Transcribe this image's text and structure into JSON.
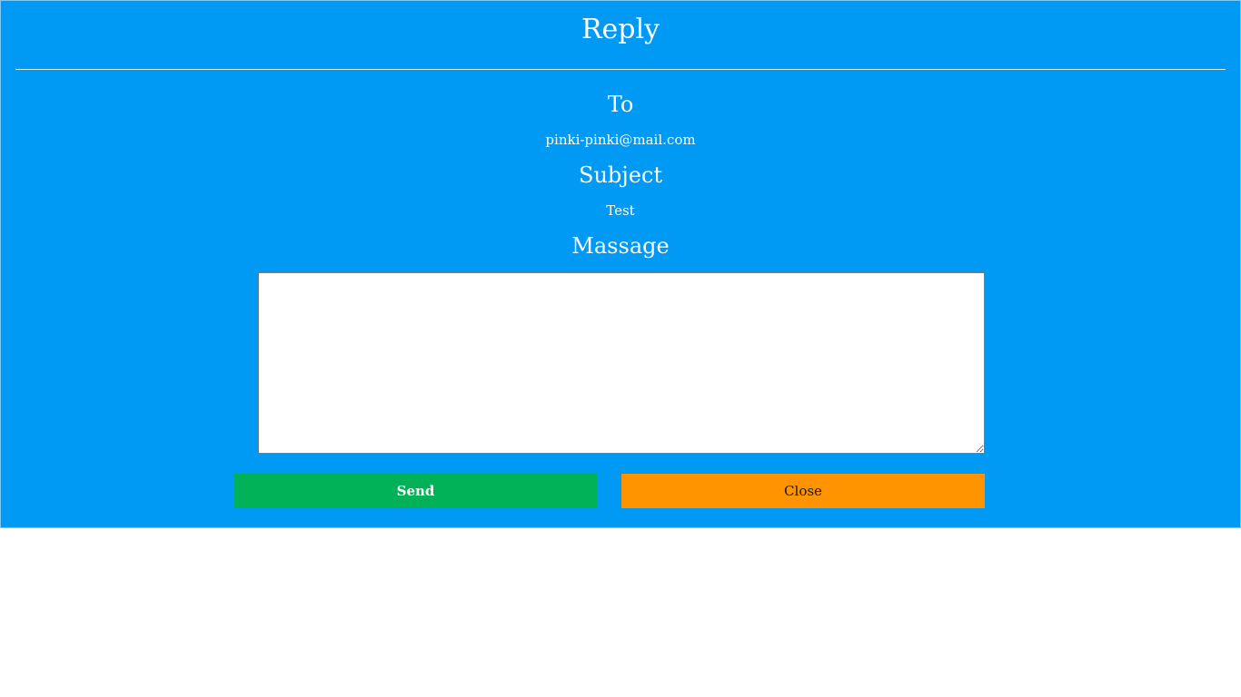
{
  "panel": {
    "title": "Reply",
    "background_color": "#0099f4"
  },
  "to": {
    "label": "To",
    "value": "pinki-pinki@mail.com"
  },
  "subject": {
    "label": "Subject",
    "value": "Test"
  },
  "message": {
    "label": "Massage",
    "value": "",
    "placeholder": ""
  },
  "actions": {
    "send_label": "Send",
    "send_color": "#00b157",
    "close_label": "Close",
    "close_color": "#ff9300"
  }
}
